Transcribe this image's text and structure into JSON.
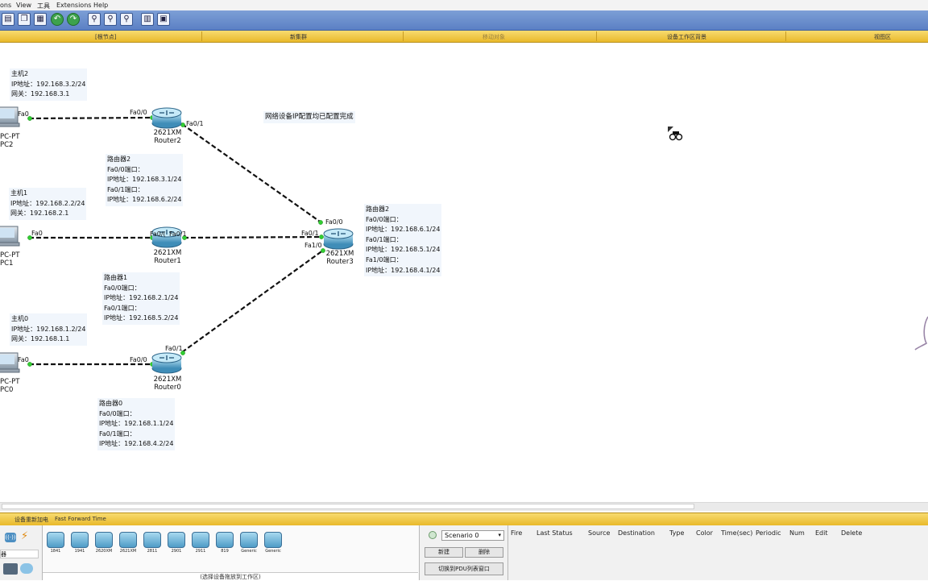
{
  "menu": [
    "ons",
    "View",
    "工具",
    "Extensions",
    "Help"
  ],
  "toolbar_icons": [
    "print-icon",
    "copy-icon",
    "paste-icon",
    "undo-icon",
    "redo-icon",
    "zoom-in-icon",
    "zoom-reset-icon",
    "zoom-out-icon",
    "palette-icon",
    "custom-device-icon"
  ],
  "workbar": {
    "root": "[根节点]",
    "new_cluster": "新集群",
    "move_object": "移动对象",
    "set_background": "设备工作区背景",
    "viewport": "视图区"
  },
  "canvas": {
    "message": "网络设备IP配置均已配置完成",
    "hosts": [
      {
        "id": "pc2",
        "type": "PC-PT",
        "name": "PC2",
        "port": "Fa0",
        "note": "主机2\nIP地址：192.168.3.2/24\n网关：192.168.3.1"
      },
      {
        "id": "pc1",
        "type": "PC-PT",
        "name": "PC1",
        "port": "Fa0",
        "note": "主机1\nIP地址：192.168.2.2/24\n网关：192.168.2.1"
      },
      {
        "id": "pc0",
        "type": "PC-PT",
        "name": "PC0",
        "port": "Fa0",
        "note": "主机0\nIP地址：192.168.1.2/24\n网关：192.168.1.1"
      }
    ],
    "routers": [
      {
        "id": "router2",
        "model": "2621XM",
        "name": "Router2",
        "ports": [
          "Fa0/0",
          "Fa0/1"
        ],
        "note": "路由器2\nFa0/0端口：\nIP地址：192.168.3.1/24\nFa0/1端口：\nIP地址：192.168.6.2/24"
      },
      {
        "id": "router1",
        "model": "2621XM",
        "name": "Router1",
        "ports": [
          "Fa0/(",
          "Fa0/1"
        ],
        "note": "路由器1\nFa0/0端口：\nIP地址：192.168.2.1/24\nFa0/1端口：\nIP地址：192.168.5.2/24"
      },
      {
        "id": "router0",
        "model": "2621XM",
        "name": "Router0",
        "ports": [
          "Fa0/0",
          "Fa0/1"
        ],
        "note": "路由器0\nFa0/0端口：\nIP地址：192.168.1.1/24\nFa0/1端口：\nIP地址：192.168.4.2/24"
      },
      {
        "id": "router3",
        "model": "2621XM",
        "name": "Router3",
        "ports": [
          "Fa0/0",
          "Fa0/1",
          "Fa1/0"
        ],
        "note": "路由器2\nFa0/0端口：\nIP地址：192.168.6.1/24\nFa0/1端口：\nIP地址：192.168.5.1/24\nFa1/0端口：\nIP地址：192.168.4.1/24"
      }
    ]
  },
  "status": {
    "power_cycle": "设备重新加电",
    "fast_forward": "Fast Forward Time"
  },
  "bottom": {
    "category_label": "器",
    "devices": [
      "1841",
      "1941",
      "2620XM",
      "2621XM",
      "2811",
      "2901",
      "2911",
      "819",
      "Generic",
      "Generic"
    ],
    "hint": "(选择设备拖放到工作区)",
    "scenario": "Scenario 0",
    "new_label": "新建",
    "delete_label": "删除",
    "switch_label": "切换到PDU列表窗口",
    "pdu_columns": [
      "Fire",
      "Last Status",
      "Source",
      "Destination",
      "Type",
      "Color",
      "Time(sec)",
      "Periodic",
      "Num",
      "Edit",
      "Delete"
    ]
  }
}
